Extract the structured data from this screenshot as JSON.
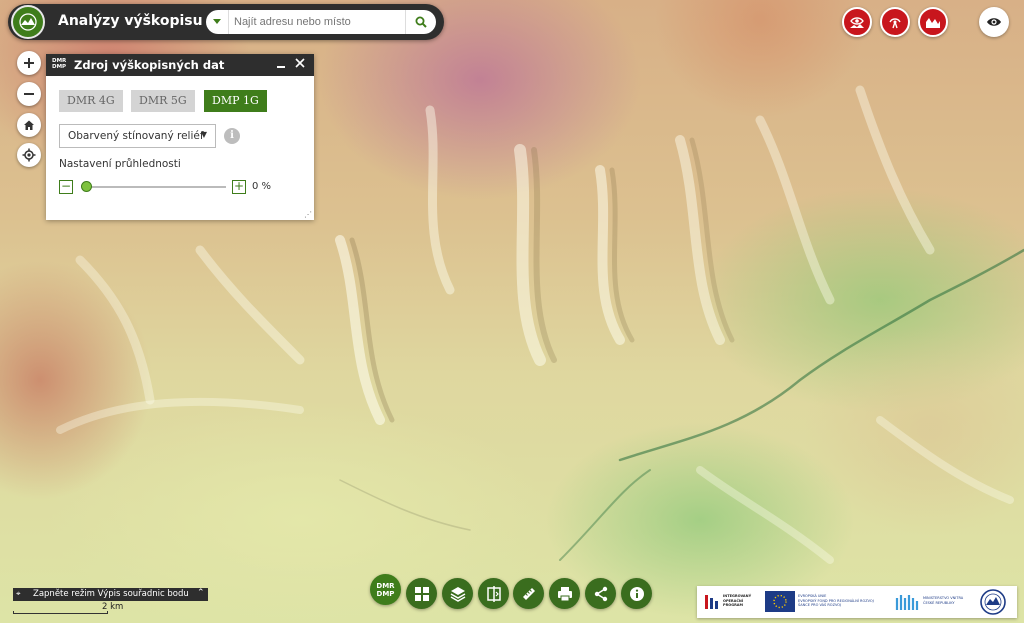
{
  "app": {
    "title": "Analýzy výškopisu"
  },
  "search": {
    "placeholder": "Najít adresu nebo místo",
    "value": ""
  },
  "panel": {
    "icon_text_top": "DMR",
    "icon_text_bottom": "DMP",
    "title": "Zdroj výškopisných dat",
    "sources": [
      {
        "label": "DMR 4G",
        "active": false
      },
      {
        "label": "DMR 5G",
        "active": false
      },
      {
        "label": "DMP 1G",
        "active": true
      }
    ],
    "visualization": {
      "selected": "Obarvený stínovaný reliéf"
    },
    "transparency": {
      "label": "Nastavení průhlednosti",
      "value_text": "0 %",
      "value": 0
    }
  },
  "toolbar": {
    "dmr_top": "DMR",
    "dmr_bottom": "DMP"
  },
  "coordinates": {
    "label": "Zapněte režim Výpis souřadnic bodu"
  },
  "scale": {
    "label": "2 km"
  },
  "partners": {
    "iop": [
      "INTEGROVANÝ",
      "OPERAČNÍ",
      "PROGRAM"
    ],
    "eu": [
      "EVROPSKÁ UNIE",
      "EVROPSKÝ FOND PRO REGIONÁLNÍ ROZVOJ",
      "ŠANCE PRO VÁŠ ROZVOJ"
    ],
    "mv": [
      "MINISTERSTVO VNITRA",
      "ČESKÉ REPUBLIKY"
    ]
  },
  "colors": {
    "accent": "#3f7d1b",
    "dark": "#2e2e2e",
    "red": "#c8161d"
  },
  "icons": [
    "search-icon",
    "plus-icon",
    "minus-icon",
    "home-icon",
    "locate-icon",
    "eye-icon",
    "grid-icon",
    "layers-icon",
    "compare-icon",
    "ruler-icon",
    "print-icon",
    "share-icon",
    "info-icon"
  ]
}
